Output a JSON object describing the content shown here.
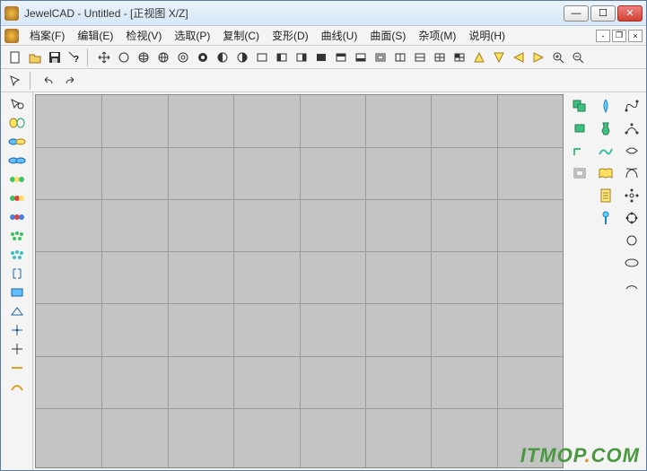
{
  "window": {
    "title": "JewelCAD - Untitled - [正视图 X/Z]"
  },
  "menu": {
    "file": "档案(F)",
    "edit": "编辑(E)",
    "view": "检视(V)",
    "select": "选取(P)",
    "copy": "复制(C)",
    "deform": "变形(D)",
    "curve": "曲线(U)",
    "surface": "曲面(S)",
    "misc": "杂项(M)",
    "help": "说明(H)"
  },
  "toolbar1": {
    "new": "new",
    "open": "open",
    "save": "save",
    "help": "help",
    "move": "move",
    "circle": "circle",
    "globe1": "globe",
    "globe2": "globe2",
    "ring1": "ring",
    "ring2": "ring2",
    "dring1": "dring1",
    "dring2": "dring2",
    "sq1": "sq1",
    "sq2": "sq2",
    "sq3": "sq3",
    "sq4": "sq4",
    "sq5": "sq5",
    "sq6": "sq6",
    "sq7": "sq7",
    "sq8": "sq8",
    "sq9": "sq9",
    "sq10": "sq10",
    "sq11": "sq11",
    "tri": "tri",
    "tri2": "tri2",
    "ltri": "ltri",
    "rtri": "rtri",
    "zoomin": "zoomin",
    "zoomout": "zoomout"
  },
  "toolbar2": {
    "pointer": "pointer",
    "undo": "undo",
    "redo": "redo"
  },
  "left_tools": [
    "pointer",
    "ellipse-y",
    "ellipse-b",
    "ellipse-pair",
    "gems-g",
    "gems-r",
    "gems-b",
    "cluster-g",
    "cluster-b",
    "bracket",
    "rect-b",
    "shape",
    "cross",
    "cross2",
    "cut",
    "arc"
  ],
  "right_col1": [
    "layer1",
    "layer2",
    "layer3",
    "layer4"
  ],
  "right_col2": [
    "drop",
    "vase",
    "wave",
    "book",
    "page",
    "pin"
  ],
  "right_col3": [
    "curve1",
    "curve2",
    "curve3",
    "curve4",
    "star",
    "circ1",
    "circ2",
    "ell1",
    "arc1"
  ],
  "watermark": {
    "t1": "ITMOP",
    "dot": ".",
    "t2": "COM"
  }
}
